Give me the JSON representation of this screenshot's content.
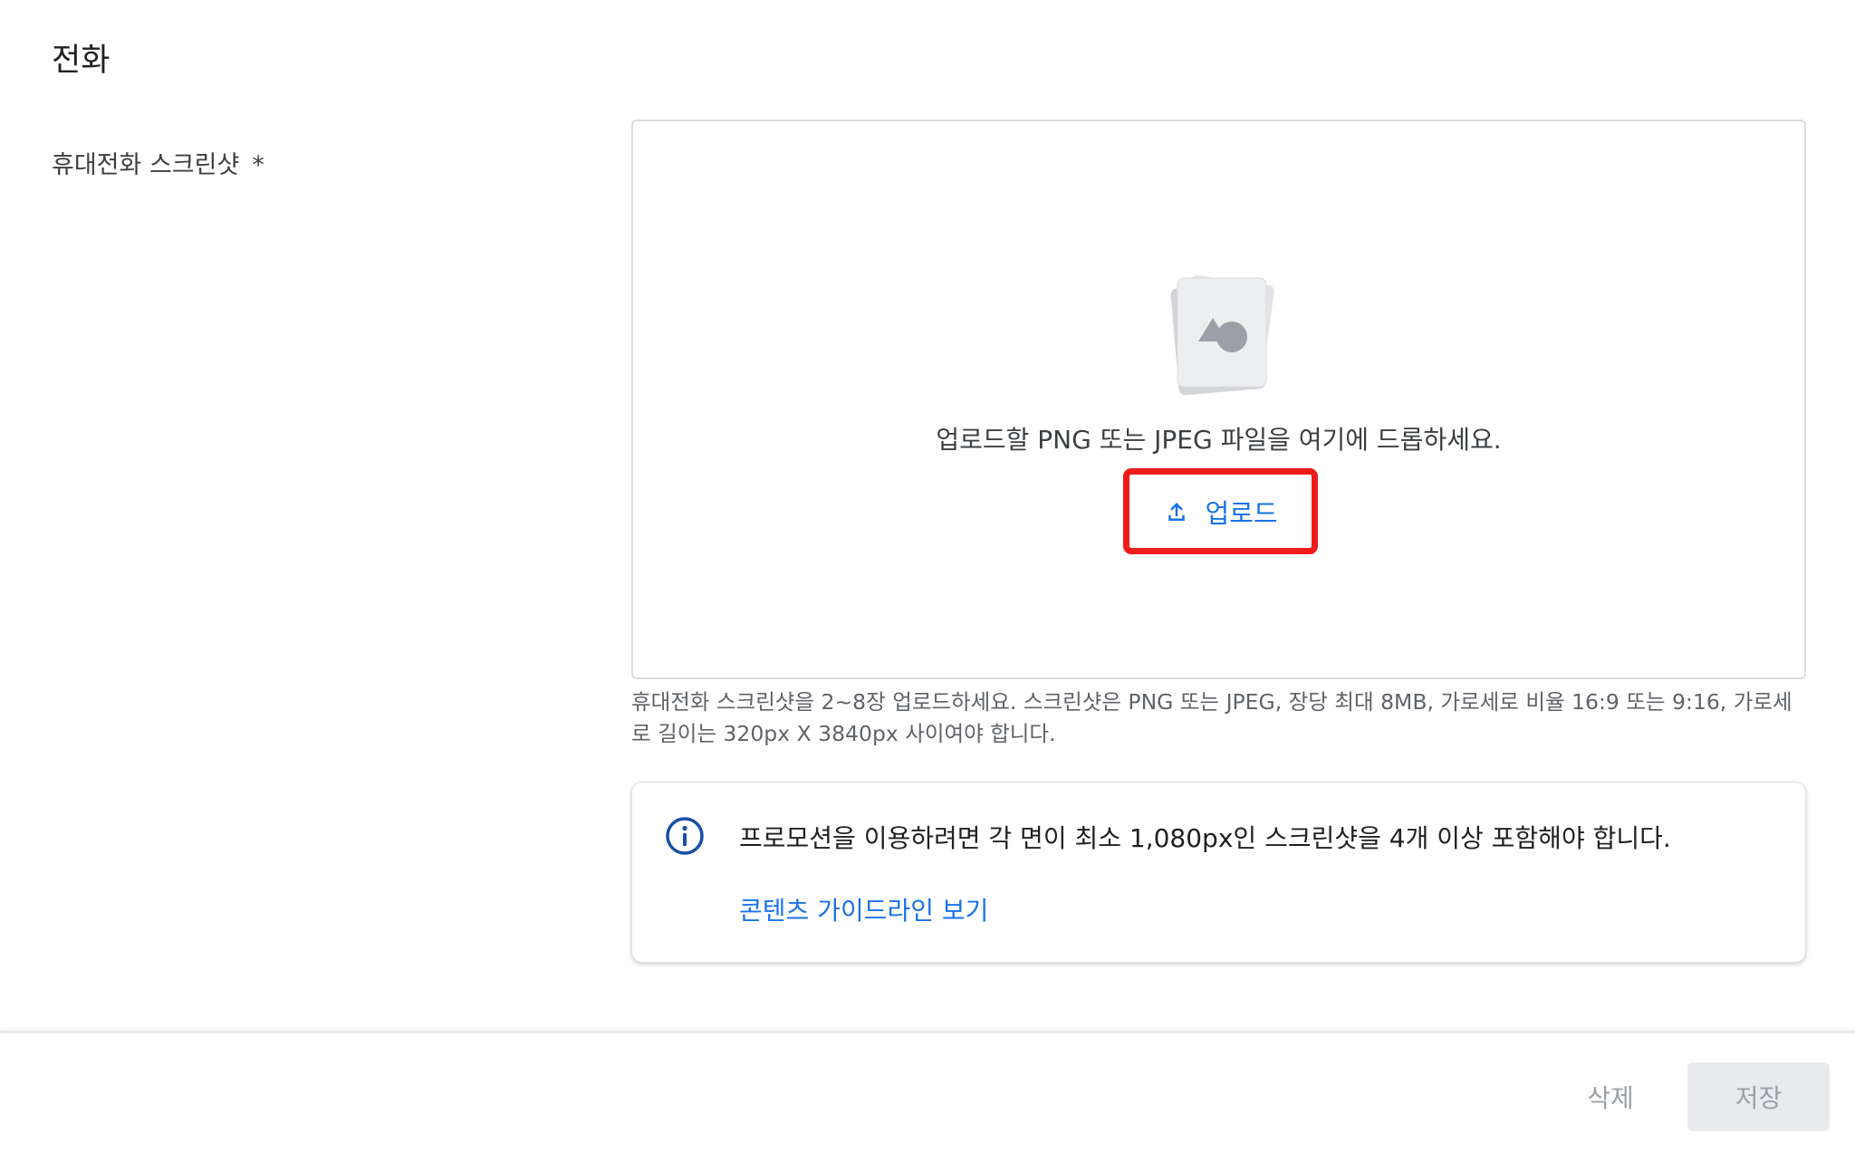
{
  "section": {
    "title": "전화"
  },
  "field": {
    "label": "휴대전화 스크린샷",
    "required_mark": "*"
  },
  "dropzone": {
    "illustration_icon": "image-file-icon",
    "drop_text": "업로드할 PNG 또는 JPEG 파일을 여기에 드롭하세요.",
    "upload_label": "업로드",
    "upload_icon": "upload-icon",
    "highlight_color": "#ef1c1c"
  },
  "help_text": "휴대전화 스크린샷을 2~8장 업로드하세요. 스크린샷은 PNG 또는 JPEG, 장당 최대 8MB, 가로세로 비율 16:9 또는 9:16, 가로세로 길이는 320px X 3840px 사이여야 합니다.",
  "info": {
    "icon": "info-icon",
    "text": "프로모션을 이용하려면 각 면이 최소 1,080px인 스크린샷을 4개 이상 포함해야 합니다.",
    "link_label": "콘텐츠 가이드라인 보기"
  },
  "footer": {
    "delete_label": "삭제",
    "save_label": "저장"
  },
  "colors": {
    "accent": "#1a73e8",
    "info_icon": "#174ea6",
    "disabled_text": "#9aa0a6",
    "disabled_bg": "#e8eaed"
  }
}
